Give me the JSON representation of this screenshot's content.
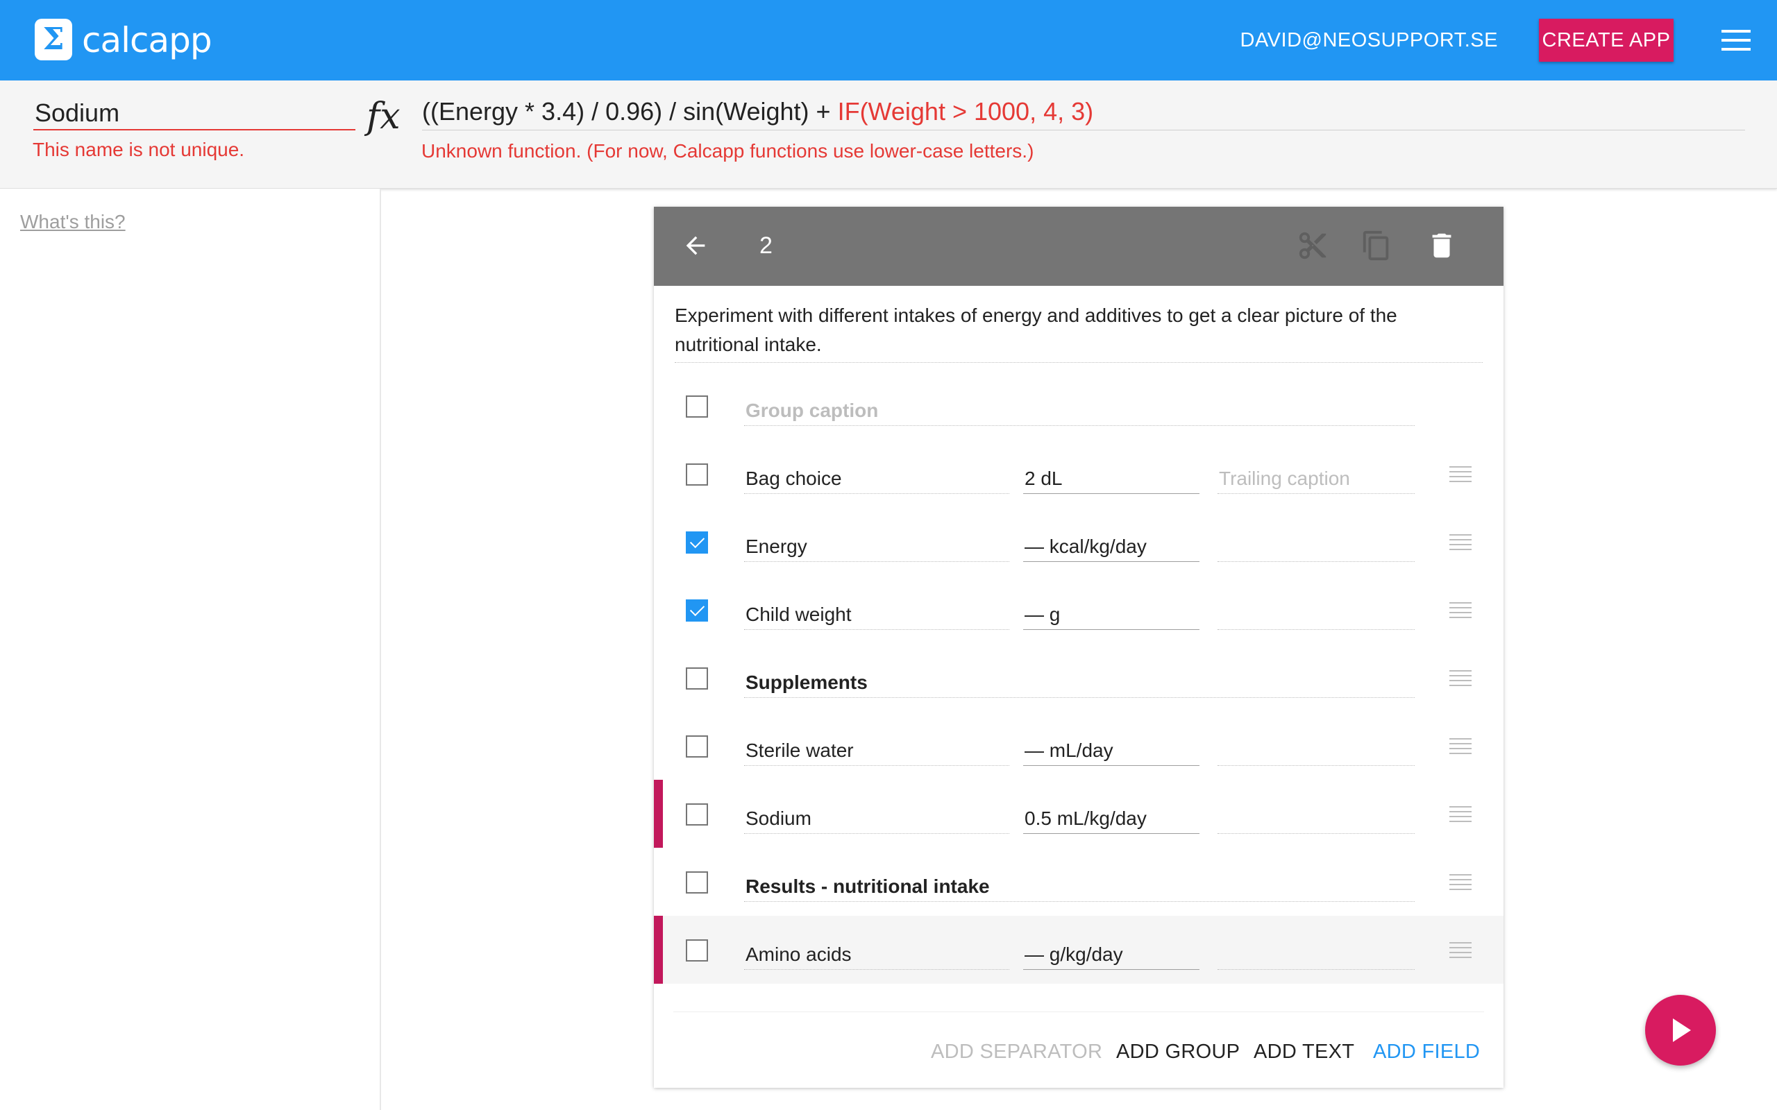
{
  "app": {
    "brand": "calcapp",
    "logo_symbol": "Σ",
    "user_email": "DAVID@NEOSUPPORT.SE",
    "create_app_label": "CREATE APP"
  },
  "formula_bar": {
    "name_value": "Sodium",
    "name_error": "This name is not unique.",
    "fx_symbol": "fx",
    "formula_ok": "((Energy * 3.4) / 0.96) / sin(Weight) + ",
    "formula_err": "IF(Weight > 1000, 4, 3)",
    "formula_error": "Unknown function. (For now, Calcapp functions use lower-case letters.)"
  },
  "left_panel": {
    "whats_this": "What's this?"
  },
  "card": {
    "screen_number": "2",
    "description": "Experiment with different intakes of energy and additives to get a clear picture of the nutritional intake.",
    "rows": [
      {
        "type": "group",
        "label": "Group caption",
        "placeholder": true,
        "checked": false,
        "marker": false,
        "highlight": false
      },
      {
        "type": "field",
        "label": "Bag choice",
        "value": "2 dL",
        "trailing": "Trailing caption",
        "checked": false,
        "marker": false,
        "highlight": false
      },
      {
        "type": "field",
        "label": "Energy",
        "value": "— kcal/kg/day",
        "trailing": "",
        "checked": true,
        "marker": false,
        "highlight": false
      },
      {
        "type": "field",
        "label": "Child weight",
        "value": "— g",
        "trailing": "",
        "checked": true,
        "marker": false,
        "highlight": false
      },
      {
        "type": "group",
        "label": "Supplements",
        "placeholder": false,
        "checked": false,
        "marker": false,
        "highlight": false
      },
      {
        "type": "field",
        "label": "Sterile water",
        "value": "— mL/day",
        "trailing": "",
        "checked": false,
        "marker": false,
        "highlight": false
      },
      {
        "type": "field",
        "label": "Sodium",
        "value": "0.5 mL/kg/day",
        "trailing": "",
        "checked": false,
        "marker": true,
        "highlight": false
      },
      {
        "type": "group",
        "label": "Results - nutritional intake",
        "placeholder": false,
        "checked": false,
        "marker": false,
        "highlight": false
      },
      {
        "type": "field",
        "label": "Amino acids",
        "value": "— g/kg/day",
        "trailing": "",
        "checked": false,
        "marker": true,
        "highlight": true
      }
    ],
    "actions": {
      "add_separator": "ADD SEPARATOR",
      "add_group": "ADD GROUP",
      "add_text": "ADD TEXT",
      "add_field": "ADD FIELD"
    }
  },
  "colors": {
    "primary": "#2196f3",
    "accent": "#d81b60",
    "error": "#e53935",
    "header_grey": "#757575",
    "marker": "#c2185b"
  },
  "icons": {
    "menu": "menu-icon",
    "back": "arrow-left-icon",
    "cut": "scissors-icon",
    "copy": "copy-icon",
    "delete": "trash-icon",
    "drag": "drag-handle-icon",
    "fab": "play-icon"
  }
}
